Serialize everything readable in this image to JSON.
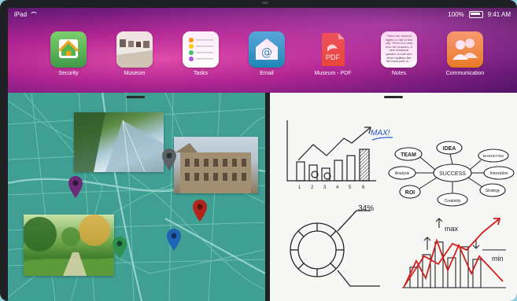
{
  "status": {
    "device": "iPad",
    "battery": "100%",
    "time": "9:41 AM"
  },
  "apps": [
    {
      "name": "security",
      "label": "Security"
    },
    {
      "name": "museum",
      "label": "Museum"
    },
    {
      "name": "tasks",
      "label": "Tasks"
    },
    {
      "name": "email",
      "label": "Email"
    },
    {
      "name": "museum-pdf",
      "label": "Museum - PDF",
      "icon_text": "PDF"
    },
    {
      "name": "notes",
      "label": "Notes",
      "icon_text": "There are several sights to visit in this city. There is a very nice art museum, a nice botanical garden, a mall and other facilities like the local pool or ..."
    },
    {
      "name": "communication",
      "label": "Communication"
    }
  ],
  "whiteboard": {
    "max_label": "MAX!",
    "axis_ticks": [
      "1",
      "2",
      "3",
      "4",
      "5",
      "6"
    ],
    "mindmap": {
      "center": "SUCCESS",
      "nodes": [
        "IDEA",
        "TEAM",
        "MARKETING",
        "Analysis",
        "Innovation",
        "ROI",
        "Strategy",
        "Creativity"
      ]
    },
    "donut_label": "34%",
    "chart_max": "max",
    "chart_min": "min"
  },
  "colors": {
    "map": "#3f9f93",
    "accent_purple": "#b02592",
    "pin_purple": "#6b2a78",
    "pin_gray": "#5b6265",
    "pin_red": "#b1251b",
    "pin_green": "#2f8f4d",
    "pin_blue": "#1f63b5"
  }
}
